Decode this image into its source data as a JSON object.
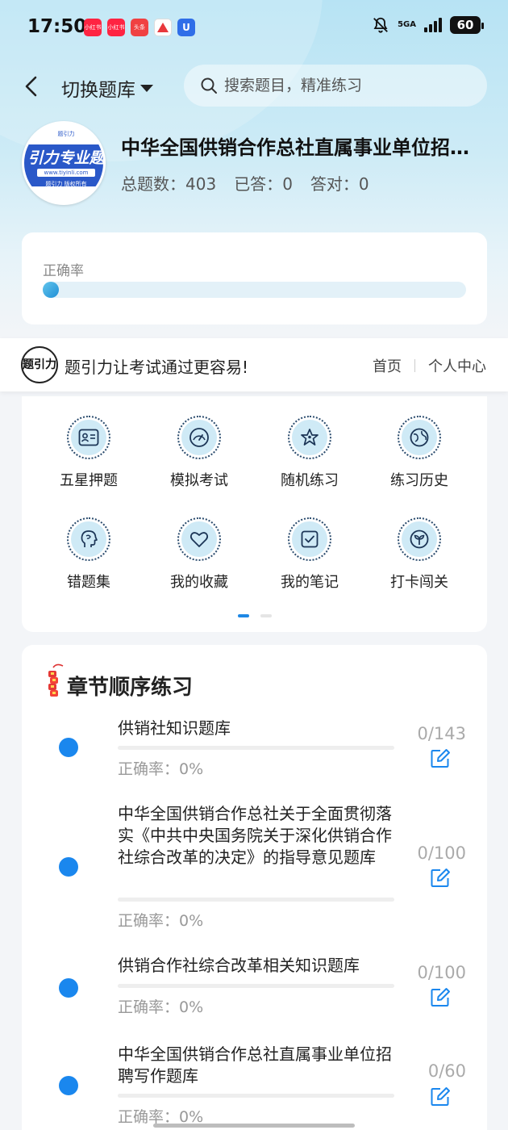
{
  "status_bar": {
    "time": "17:50",
    "apps": [
      {
        "name": "xiaohongshu-app-icon",
        "text": "小红书",
        "color": "#ff2442"
      },
      {
        "name": "xiaohongshu-app-icon-2",
        "text": "小红书",
        "color": "#ff2442"
      },
      {
        "name": "toutiao-app-icon",
        "text": "头条",
        "color": "#f04142"
      },
      {
        "name": "triangle-app-icon",
        "text": "",
        "color": "#ffffff"
      },
      {
        "name": "u-app-icon",
        "text": "U",
        "color": "#2f6ee8"
      }
    ],
    "network": "5GA",
    "battery": "60"
  },
  "header": {
    "switch_label": "切换题库",
    "search_placeholder": "搜索题目，精准练习"
  },
  "bank": {
    "logo_brand": "引力专业题",
    "logo_url": "www.tiyinli.com",
    "logo_copy": "题引力 版权所有",
    "logo_top": "题引力",
    "title": "中华全国供销合作总社直属事业单位招聘考试题库",
    "stats": [
      {
        "label": "总题数：",
        "value": "403"
      },
      {
        "label": "已答：",
        "value": "0"
      },
      {
        "label": "答对：",
        "value": "0"
      }
    ]
  },
  "accuracy": {
    "label": "正确率",
    "fraction": 0
  },
  "promo": {
    "logo_text": "题引力",
    "slogan": "题引力让考试通过更容易!",
    "links": [
      "首页",
      "个人中心"
    ]
  },
  "features": [
    {
      "label": "五星押题",
      "icon": "id-card-icon"
    },
    {
      "label": "模拟考试",
      "icon": "speedometer-icon"
    },
    {
      "label": "随机练习",
      "icon": "star-network-icon"
    },
    {
      "label": "练习历史",
      "icon": "globe-icon"
    },
    {
      "label": "错题集",
      "icon": "head-icon"
    },
    {
      "label": "我的收藏",
      "icon": "heart-icon"
    },
    {
      "label": "我的笔记",
      "icon": "note-check-icon"
    },
    {
      "label": "打卡闯关",
      "icon": "sprout-icon"
    }
  ],
  "pager": {
    "pages": 2,
    "active": 0
  },
  "chapters": {
    "title": "章节顺序练习",
    "items": [
      {
        "name": "供销社知识题库",
        "rate": "正确率：0%",
        "count": "0/143"
      },
      {
        "name": "中华全国供销合作总社关于全面贯彻落实《中共中央国务院关于深化供销合作社综合改革的决定》的指导意见题库",
        "rate": "正确率：0%",
        "count": "0/100"
      },
      {
        "name": "供销合作社综合改革相关知识题库",
        "rate": "正确率：0%",
        "count": "0/100"
      },
      {
        "name": "中华全国供销合作总社直属事业单位招聘写作题库",
        "rate": "正确率：0%",
        "count": "0/60"
      }
    ]
  },
  "colors": {
    "accent": "#1a87ee",
    "icon_fill": "#cfeaf6",
    "icon_stroke": "#2b4c6e"
  }
}
